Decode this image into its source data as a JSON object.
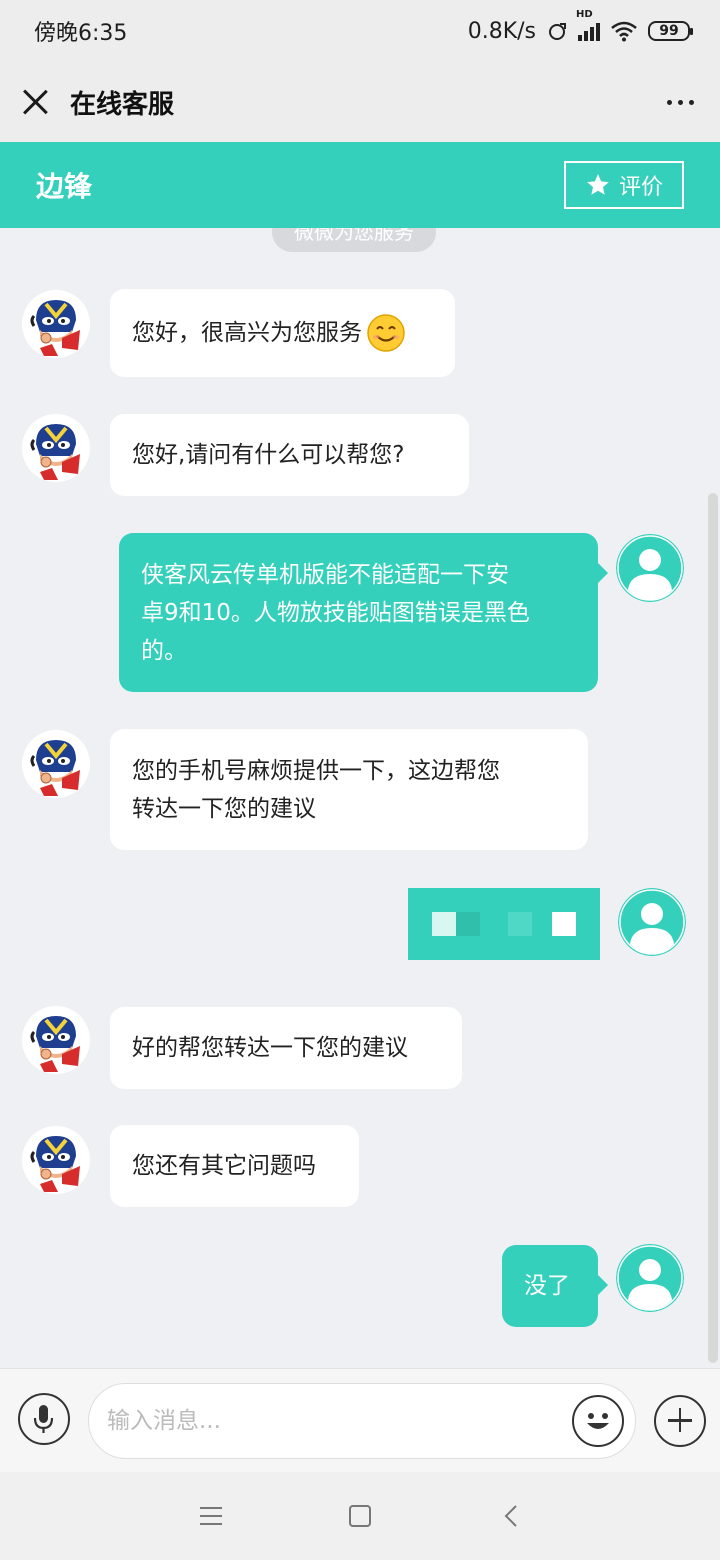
{
  "status_bar": {
    "time": "傍晚6:35",
    "network_speed": "0.8K/s",
    "hd_label": "HD",
    "battery": "99"
  },
  "title_bar": {
    "title": "在线客服"
  },
  "agent_bar": {
    "agent_name": "边锋",
    "rate_label": "评价",
    "accent_color": "#35d0bb"
  },
  "chat": {
    "system_notice": "微微为您服务",
    "messages": [
      {
        "from": "agent",
        "text": "您好，很高兴为您服务",
        "emoji": "smiling-face"
      },
      {
        "from": "agent",
        "text": "您好,请问有什么可以帮您?"
      },
      {
        "from": "user",
        "lines": [
          "侠客风云传单机版能不能适配一下安",
          "卓9和10。人物放技能贴图错误是黑色",
          "的。"
        ]
      },
      {
        "from": "agent",
        "lines": [
          "您的手机号麻烦提供一下，这边帮您",
          "转达一下您的建议"
        ]
      },
      {
        "from": "user",
        "text": "",
        "redacted": true
      },
      {
        "from": "agent",
        "text": "好的帮您转达一下您的建议"
      },
      {
        "from": "agent",
        "text": "您还有其它问题吗"
      },
      {
        "from": "user",
        "text": "没了"
      }
    ]
  },
  "input_bar": {
    "placeholder": "输入消息..."
  }
}
